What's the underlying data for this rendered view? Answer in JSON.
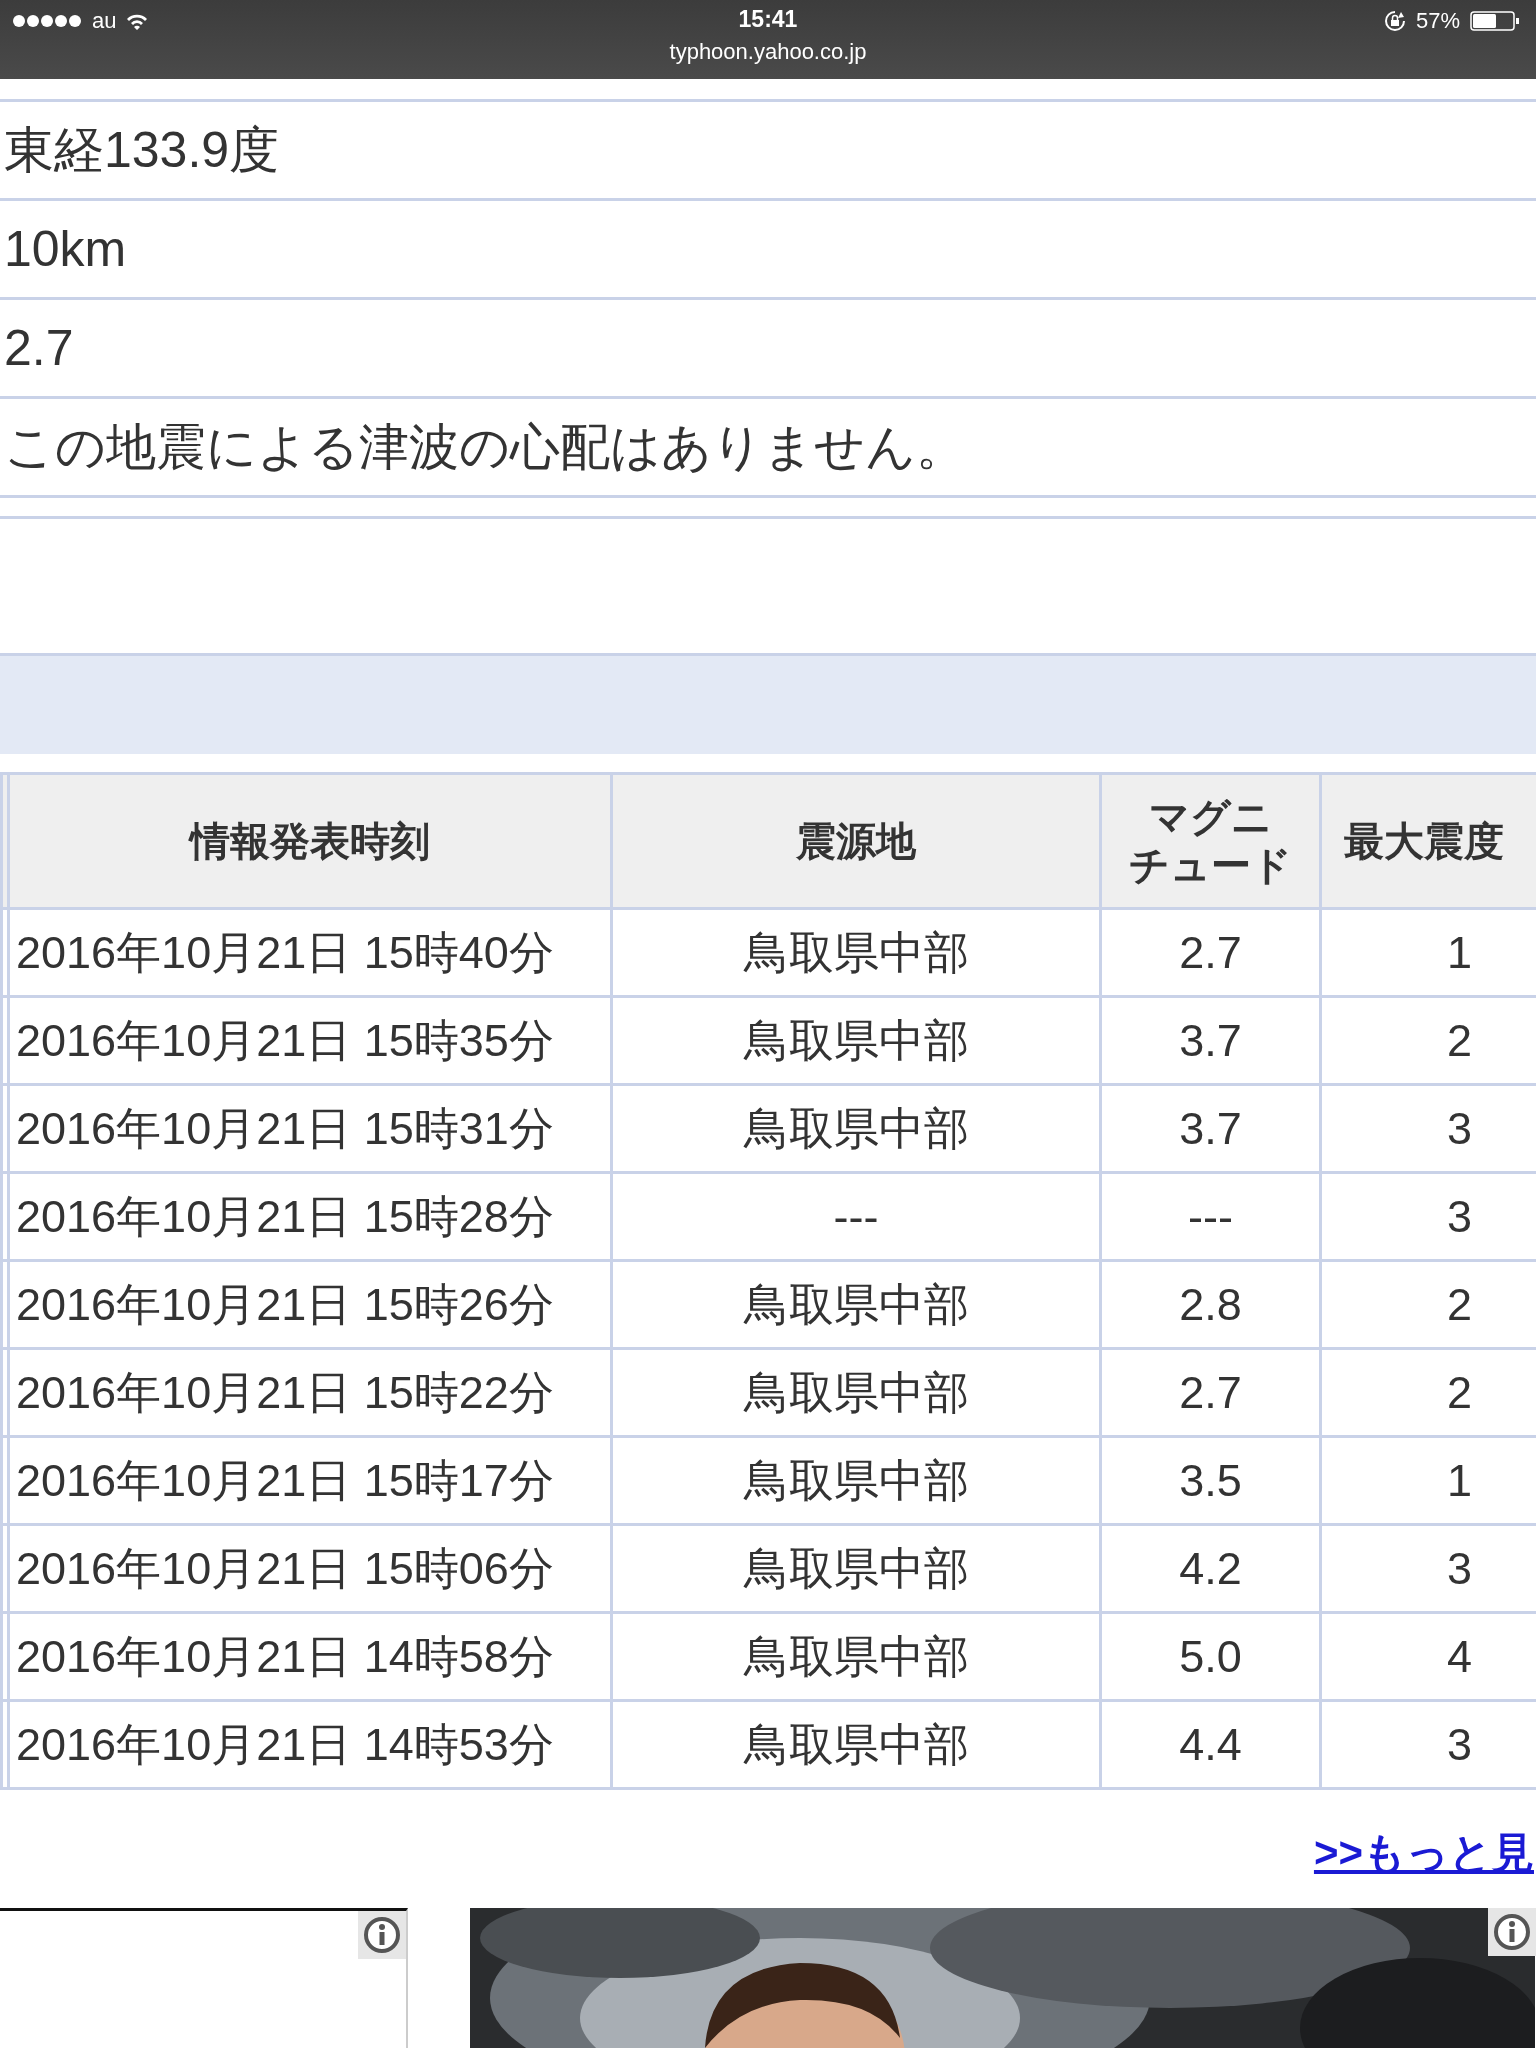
{
  "status_bar": {
    "carrier": "au",
    "time": "15:41",
    "url": "typhoon.yahoo.co.jp",
    "battery": "57%"
  },
  "details": [
    "東経133.9度",
    "10km",
    "2.7",
    "この地震による津波の心配はありません。"
  ],
  "table": {
    "columns": [
      "情報発表時刻",
      "震源地",
      "マグニチュード",
      "最大震度"
    ],
    "rows": [
      [
        "2016年10月21日 15時40分",
        "鳥取県中部",
        "2.7",
        "1"
      ],
      [
        "2016年10月21日 15時35分",
        "鳥取県中部",
        "3.7",
        "2"
      ],
      [
        "2016年10月21日 15時31分",
        "鳥取県中部",
        "3.7",
        "3"
      ],
      [
        "2016年10月21日 15時28分",
        "---",
        "---",
        "3"
      ],
      [
        "2016年10月21日 15時26分",
        "鳥取県中部",
        "2.8",
        "2"
      ],
      [
        "2016年10月21日 15時22分",
        "鳥取県中部",
        "2.7",
        "2"
      ],
      [
        "2016年10月21日 15時17分",
        "鳥取県中部",
        "3.5",
        "1"
      ],
      [
        "2016年10月21日 15時06分",
        "鳥取県中部",
        "4.2",
        "3"
      ],
      [
        "2016年10月21日 14時58分",
        "鳥取県中部",
        "5.0",
        "4"
      ],
      [
        "2016年10月21日 14時53分",
        "鳥取県中部",
        "4.4",
        "3"
      ]
    ]
  },
  "more_link": ">>もっと見"
}
